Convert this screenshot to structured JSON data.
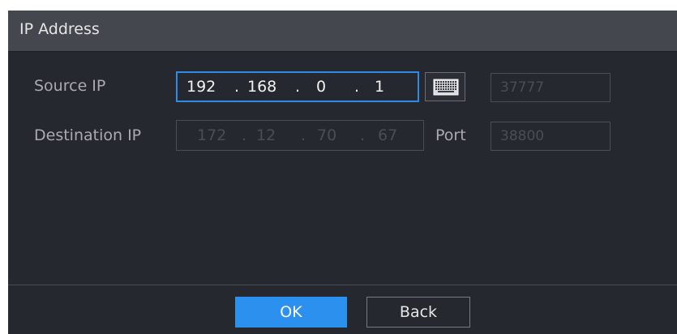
{
  "dialog": {
    "title": "IP Address"
  },
  "form": {
    "source_label": "Source IP",
    "destination_label": "Destination IP",
    "port_label": "Port",
    "source_ip": {
      "octets": [
        "192",
        "168",
        "0",
        "1"
      ],
      "separator": "."
    },
    "destination_ip": {
      "octets": [
        "172",
        "12",
        "70",
        "67"
      ],
      "separator": "."
    },
    "source_port": "37777",
    "destination_port": "38800"
  },
  "icons": {
    "keyboard": "keyboard-icon"
  },
  "buttons": {
    "ok_label": "OK",
    "back_label": "Back"
  },
  "colors": {
    "accent": "#2b90ee",
    "focus_border": "#2d8be6",
    "background": "#262830",
    "titlebar": "#44474d"
  }
}
